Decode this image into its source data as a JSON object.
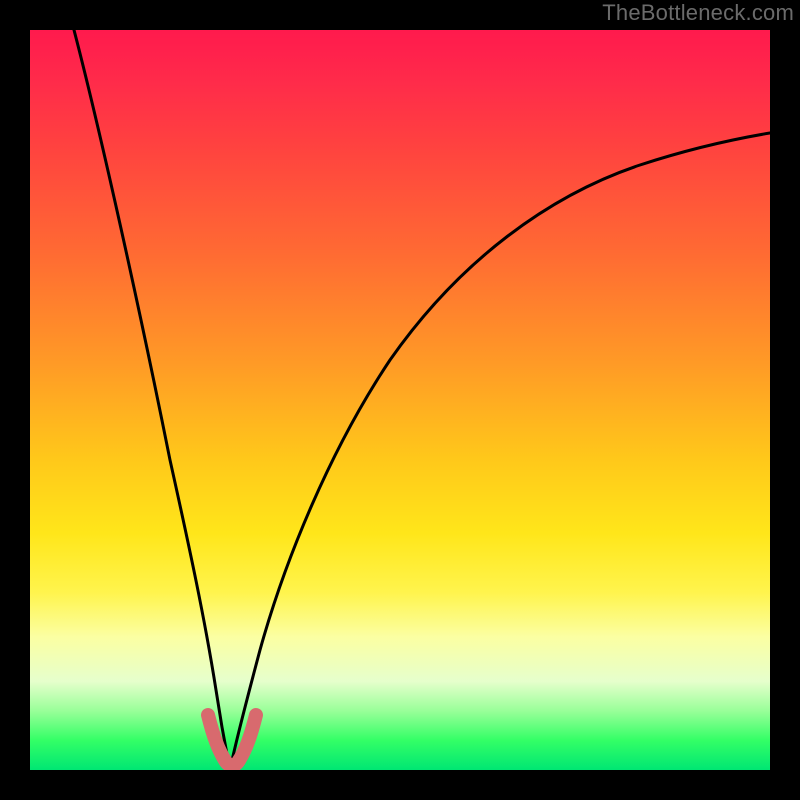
{
  "watermark": "TheBottleneck.com",
  "chart_data": {
    "type": "line",
    "title": "",
    "xlabel": "",
    "ylabel": "",
    "xlim": [
      0,
      100
    ],
    "ylim": [
      0,
      100
    ],
    "series": [
      {
        "name": "left-curve",
        "x": [
          6,
          9,
          12,
          15,
          18,
          20,
          22,
          23.5,
          24.8,
          25.6,
          26.2,
          26.7,
          27
        ],
        "y": [
          100,
          86,
          72,
          57,
          42,
          30,
          19,
          11,
          6,
          3,
          1.5,
          0.7,
          0
        ]
      },
      {
        "name": "right-curve",
        "x": [
          27,
          28,
          30,
          33,
          36,
          40,
          45,
          52,
          60,
          70,
          80,
          90,
          100
        ],
        "y": [
          0,
          3,
          10,
          20,
          30,
          40,
          50,
          60,
          68,
          75,
          80,
          84,
          86
        ]
      }
    ],
    "highlight": {
      "name": "bottom-u-mark",
      "x": [
        24,
        25,
        25.8,
        26.6,
        27.2,
        28,
        29,
        30.2
      ],
      "y": [
        8,
        5,
        2.5,
        1.2,
        1.2,
        2.5,
        5,
        8
      ]
    },
    "background_gradient": {
      "top": "#ff1a4d",
      "mid_upper": "#ff9a26",
      "mid": "#ffe61a",
      "mid_lower": "#e6ffcc",
      "bottom": "#00e673"
    }
  }
}
